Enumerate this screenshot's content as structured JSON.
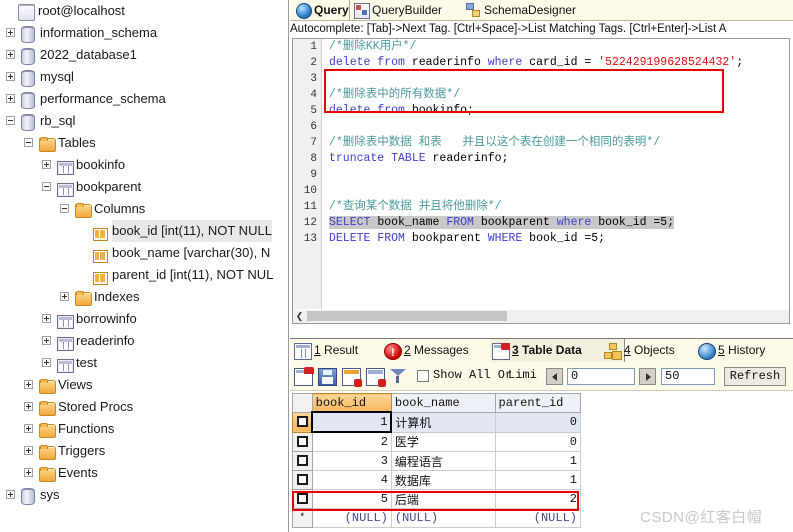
{
  "tree": {
    "root": {
      "label": "root@localhost",
      "icon": "server-icon"
    },
    "items": [
      {
        "label": "information_schema",
        "icon": "database-icon",
        "indent": 0,
        "expander": "plus"
      },
      {
        "label": "2022_database1",
        "icon": "database-icon",
        "indent": 0,
        "expander": "plus"
      },
      {
        "label": "mysql",
        "icon": "database-icon",
        "indent": 0,
        "expander": "plus"
      },
      {
        "label": "performance_schema",
        "icon": "database-icon",
        "indent": 0,
        "expander": "plus"
      },
      {
        "label": "rb_sql",
        "icon": "database-icon",
        "indent": 0,
        "expander": "minus"
      },
      {
        "label": "Tables",
        "icon": "folder-icon",
        "indent": 1,
        "expander": "minus"
      },
      {
        "label": "bookinfo",
        "icon": "table-icon",
        "indent": 2,
        "expander": "plus"
      },
      {
        "label": "bookparent",
        "icon": "table-icon",
        "indent": 2,
        "expander": "minus"
      },
      {
        "label": "Columns",
        "icon": "folder-icon",
        "indent": 3,
        "expander": "minus"
      },
      {
        "label": "book_id [int(11), NOT NULL",
        "icon": "column-icon",
        "indent": 4,
        "expander": "none",
        "selected": true
      },
      {
        "label": "book_name [varchar(30), N",
        "icon": "column-icon",
        "indent": 4,
        "expander": "none"
      },
      {
        "label": "parent_id [int(11), NOT NUL",
        "icon": "column-icon",
        "indent": 4,
        "expander": "none"
      },
      {
        "label": "Indexes",
        "icon": "folder-icon",
        "indent": 3,
        "expander": "plus"
      },
      {
        "label": "borrowinfo",
        "icon": "table-icon",
        "indent": 2,
        "expander": "plus"
      },
      {
        "label": "readerinfo",
        "icon": "table-icon",
        "indent": 2,
        "expander": "plus"
      },
      {
        "label": "test",
        "icon": "table-icon",
        "indent": 2,
        "expander": "plus"
      },
      {
        "label": "Views",
        "icon": "folder-icon",
        "indent": 1,
        "expander": "plus"
      },
      {
        "label": "Stored Procs",
        "icon": "folder-icon",
        "indent": 1,
        "expander": "plus"
      },
      {
        "label": "Functions",
        "icon": "folder-icon",
        "indent": 1,
        "expander": "plus"
      },
      {
        "label": "Triggers",
        "icon": "folder-icon",
        "indent": 1,
        "expander": "plus"
      },
      {
        "label": "Events",
        "icon": "folder-icon",
        "indent": 1,
        "expander": "plus"
      },
      {
        "label": "sys",
        "icon": "database-icon",
        "indent": 0,
        "expander": "plus"
      }
    ]
  },
  "editor_tabs": [
    {
      "label": "Query",
      "icon": "globe-icon",
      "active": true
    },
    {
      "label": "QueryBuilder",
      "icon": "querybuilder-icon",
      "active": false
    },
    {
      "label": "SchemaDesigner",
      "icon": "schemadesigner-icon",
      "active": false
    }
  ],
  "autocomplete_hint": "Autocomplete: [Tab]->Next Tag. [Ctrl+Space]->List Matching Tags. [Ctrl+Enter]->List A",
  "editor": {
    "line_numbers": [
      "1",
      "2",
      "3",
      "4",
      "5",
      "6",
      "7",
      "8",
      "9",
      "10",
      "11",
      "12",
      "13"
    ],
    "lines": [
      {
        "n": 1,
        "tokens": [
          {
            "t": "/*删除KK用户*/",
            "c": "cm"
          }
        ]
      },
      {
        "n": 2,
        "tokens": [
          {
            "t": "delete from ",
            "c": "k"
          },
          {
            "t": "readerinfo ",
            "c": "pl"
          },
          {
            "t": "where ",
            "c": "k"
          },
          {
            "t": "card_id = ",
            "c": "pl"
          },
          {
            "t": "'522429199628524432'",
            "c": "str"
          },
          {
            "t": ";",
            "c": "pl"
          }
        ]
      },
      {
        "n": 3,
        "tokens": [
          {
            "t": "",
            "c": "pl"
          }
        ]
      },
      {
        "n": 4,
        "tokens": [
          {
            "t": "/*删除表中的所有数据*/",
            "c": "cm"
          }
        ]
      },
      {
        "n": 5,
        "tokens": [
          {
            "t": "delete from ",
            "c": "k"
          },
          {
            "t": "bookinfo;",
            "c": "pl"
          }
        ]
      },
      {
        "n": 6,
        "tokens": [
          {
            "t": "",
            "c": "pl"
          }
        ]
      },
      {
        "n": 7,
        "tokens": [
          {
            "t": "/*删除表中数据 和表   并且以这个表在创建一个相同的表明*/",
            "c": "cm"
          }
        ]
      },
      {
        "n": 8,
        "tokens": [
          {
            "t": "truncate TABLE ",
            "c": "k"
          },
          {
            "t": "readerinfo;",
            "c": "pl"
          }
        ]
      },
      {
        "n": 9,
        "tokens": [
          {
            "t": "",
            "c": "pl"
          }
        ]
      },
      {
        "n": 10,
        "tokens": [
          {
            "t": "",
            "c": "pl"
          }
        ]
      },
      {
        "n": 11,
        "tokens": [
          {
            "t": "/*查询某个数据 并且将他删除*/",
            "c": "cm"
          }
        ]
      },
      {
        "n": 12,
        "tokens": [
          {
            "t": "SELECT ",
            "c": "k selbg"
          },
          {
            "t": "book_name ",
            "c": "pl selbg"
          },
          {
            "t": "FROM ",
            "c": "k selbg"
          },
          {
            "t": "bookparent ",
            "c": "pl selbg"
          },
          {
            "t": "where ",
            "c": "k selbg"
          },
          {
            "t": "book_id =5;",
            "c": "pl selbg"
          }
        ]
      },
      {
        "n": 13,
        "tokens": [
          {
            "t": "DELETE FROM ",
            "c": "k"
          },
          {
            "t": "bookparent ",
            "c": "pl"
          },
          {
            "t": "WHERE ",
            "c": "k"
          },
          {
            "t": "book_id =5;",
            "c": "pl"
          }
        ]
      }
    ],
    "highlight_box_color": "#e60000"
  },
  "result_tabs": [
    {
      "num": "1",
      "label": "Result",
      "icon": "grid-icon",
      "active": false
    },
    {
      "num": "2",
      "label": "Messages",
      "icon": "info-icon",
      "active": false
    },
    {
      "num": "3",
      "label": "Table Data",
      "icon": "tabledata-icon",
      "active": true
    },
    {
      "num": "4",
      "label": "Objects",
      "icon": "objects-icon",
      "active": false
    },
    {
      "num": "5",
      "label": "History",
      "icon": "history-icon",
      "active": false
    }
  ],
  "grid_toolbar": {
    "icons": [
      "new-record-icon",
      "save-icon",
      "delete-record-icon",
      "edit-record-icon",
      "filter-icon"
    ],
    "show_all_label": "Show All Or",
    "limit_label": "Limi",
    "show_all_checked": false,
    "offset_value": "0",
    "limit_value": "50",
    "refresh_label": "Refresh",
    "prev_icon": "prev-arrow-icon",
    "next_icon": "next-arrow-icon"
  },
  "datagrid": {
    "columns": [
      "book_id",
      "book_name",
      "parent_id"
    ],
    "active_column": "book_id",
    "rows": [
      {
        "marker": "box",
        "book_id": "1",
        "book_name": "计算机",
        "parent_id": "0",
        "selected": true,
        "focus_cell": "book_id"
      },
      {
        "marker": "box",
        "book_id": "2",
        "book_name": "医学",
        "parent_id": "0"
      },
      {
        "marker": "box",
        "book_id": "3",
        "book_name": "编程语言",
        "parent_id": "1"
      },
      {
        "marker": "box",
        "book_id": "4",
        "book_name": "数据库",
        "parent_id": "1"
      },
      {
        "marker": "box",
        "book_id": "5",
        "book_name": "后端",
        "parent_id": "2",
        "highlighted": true
      },
      {
        "marker": "*",
        "book_id": "(NULL)",
        "book_name": "(NULL)",
        "parent_id": "(NULL)",
        "isnull": true
      }
    ],
    "highlight_box_color": "#e60000"
  },
  "watermark": "CSDN@红客白帽"
}
